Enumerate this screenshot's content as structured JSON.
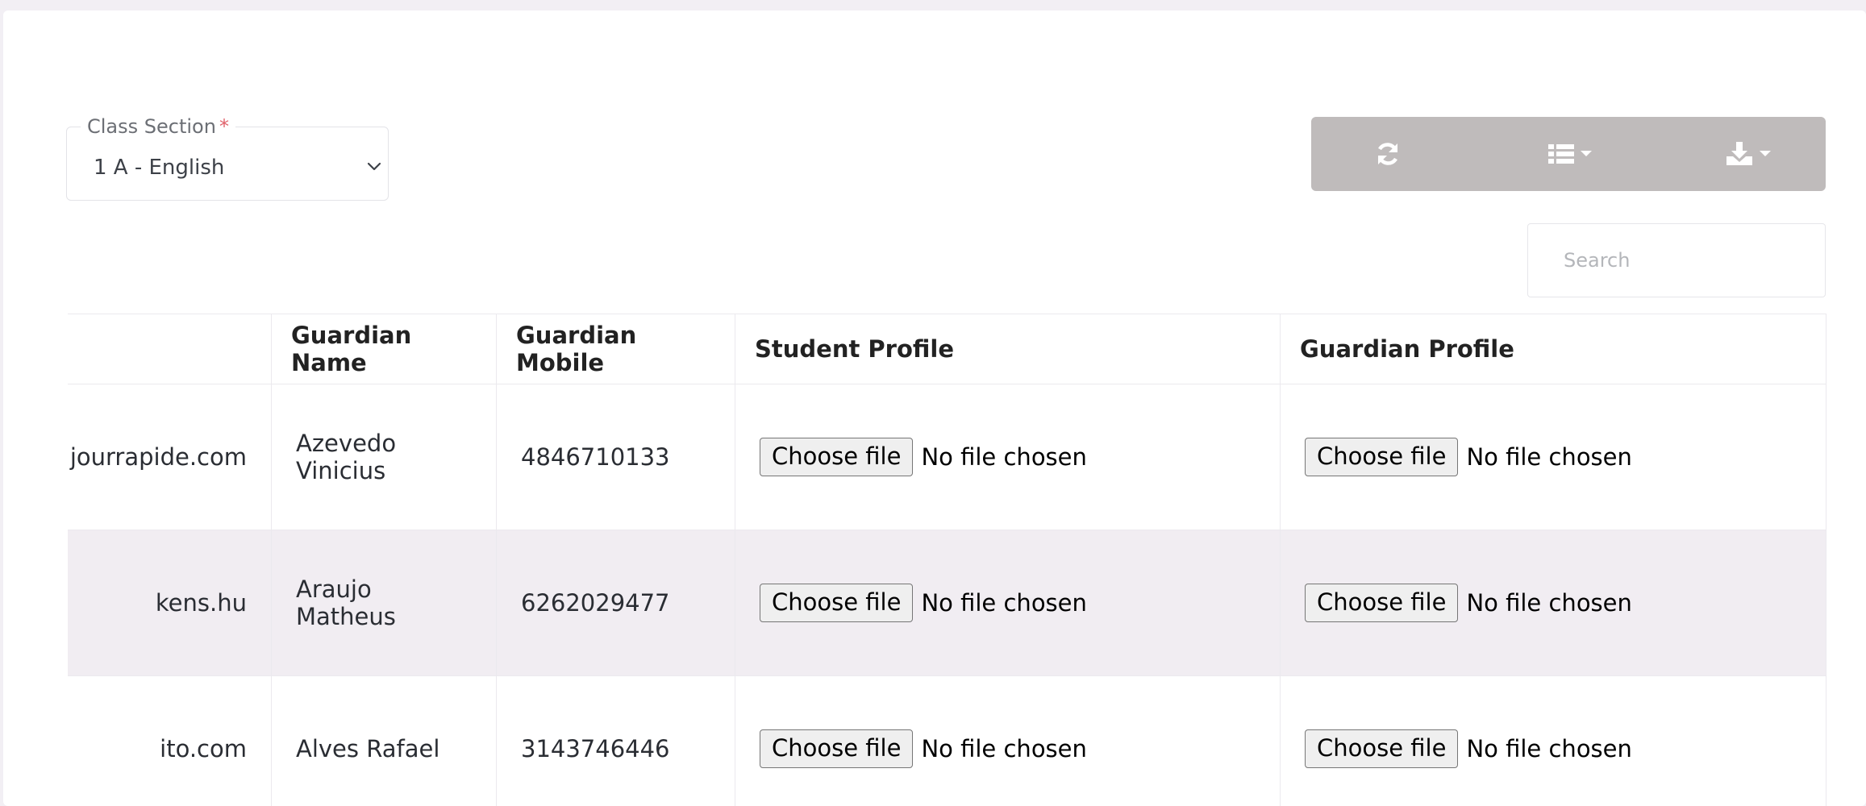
{
  "filter": {
    "label": "Class Section",
    "required_mark": "*",
    "selected": "1 A - English"
  },
  "toolbar": {
    "buttons": [
      {
        "icon": "refresh-icon"
      },
      {
        "icon": "columns-list-icon"
      },
      {
        "icon": "download-icon"
      }
    ],
    "bg_color": "#bfbbbb"
  },
  "search": {
    "placeholder": "Search",
    "value": ""
  },
  "table": {
    "columns": [
      "",
      "Guardian Name",
      "Guardian Mobile",
      "Student Profile",
      "Guardian Profile"
    ],
    "rows": [
      {
        "email_fragment": "jourrapide.com",
        "guardian_name": "Azevedo Vinicius",
        "guardian_mobile": "4846710133",
        "student_file": {
          "button": "Choose file",
          "status": "No file chosen"
        },
        "guardian_file": {
          "button": "Choose file",
          "status": "No file chosen"
        }
      },
      {
        "email_fragment": "kens.hu",
        "guardian_name": "Araujo Matheus",
        "guardian_mobile": "6262029477",
        "student_file": {
          "button": "Choose file",
          "status": "No file chosen"
        },
        "guardian_file": {
          "button": "Choose file",
          "status": "No file chosen"
        }
      },
      {
        "email_fragment": "ito.com",
        "guardian_name": "Alves Rafael",
        "guardian_mobile": "3143746446",
        "student_file": {
          "button": "Choose file",
          "status": "No file chosen"
        },
        "guardian_file": {
          "button": "Choose file",
          "status": "No file chosen"
        }
      }
    ]
  },
  "colors": {
    "page_bg": "#f2eff4",
    "row_alt_bg": "#f1edf2",
    "required": "#e0626b"
  }
}
